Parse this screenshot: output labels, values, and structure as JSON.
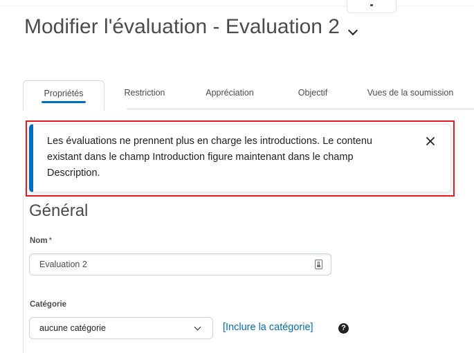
{
  "page": {
    "title": "Modifier l'évaluation - Evaluation 2"
  },
  "tabs": [
    {
      "label": "Propriétés",
      "active": true
    },
    {
      "label": "Restriction",
      "active": false
    },
    {
      "label": "Appréciation",
      "active": false
    },
    {
      "label": "Objectif",
      "active": false
    },
    {
      "label": "Vues de la soumission",
      "active": false
    }
  ],
  "alert": {
    "message": "Les évaluations ne prennent plus en charge les introductions. Le contenu existant dans le champ Introduction figure maintenant dans le champ Description.",
    "close_icon": "close-icon"
  },
  "section": {
    "title": "Général"
  },
  "form": {
    "name_label": "Nom",
    "name_required_marker": "*",
    "name_value": "Evaluation 2",
    "category_label": "Catégorie",
    "category_value": "aucune catégorie",
    "include_category_link": "[Inclure la catégorie]",
    "help_icon_glyph": "?"
  },
  "colors": {
    "accent": "#006fbf",
    "highlight": "#e6191e",
    "text": "#202122"
  }
}
